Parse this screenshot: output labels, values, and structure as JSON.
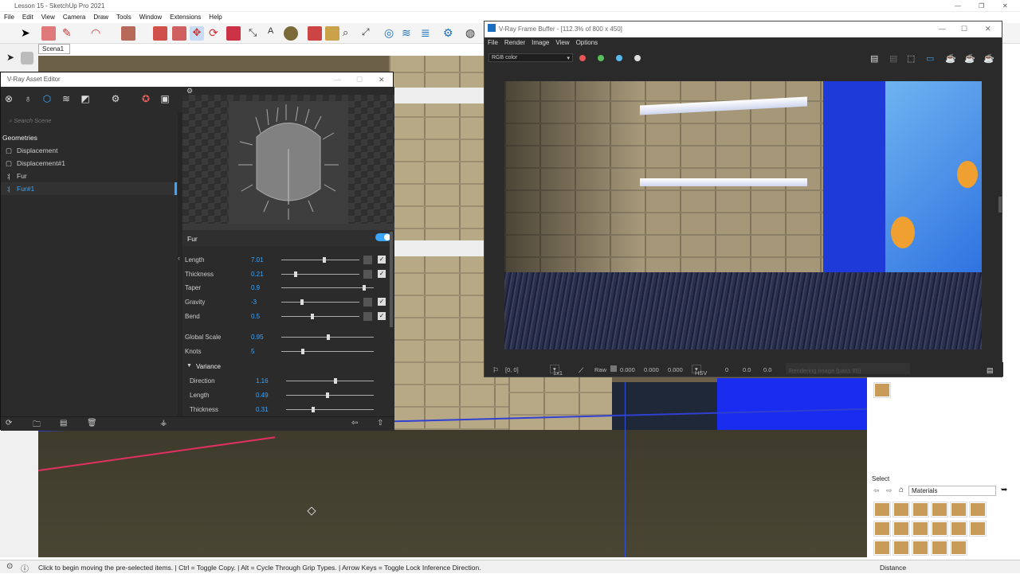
{
  "sketchup": {
    "title": "Lesson 15 - SketchUp Pro 2021",
    "menu": [
      "File",
      "Edit",
      "View",
      "Camera",
      "Draw",
      "Tools",
      "Window",
      "Extensions",
      "Help"
    ],
    "scene_tab": "Scena1",
    "status_message": "Click to begin moving the pre-selected items. | Ctrl = Toggle Copy. | Alt = Cycle Through Grip Types. | Arrow Keys = Toggle Lock Inference Direction.",
    "distance_label": "Distance",
    "materials": {
      "select_label": "Select",
      "dropdown_value": "Materials"
    }
  },
  "asset_editor": {
    "title": "V-Ray Asset Editor",
    "search_placeholder": "Search Scene",
    "category": "Geometries",
    "items": [
      {
        "label": "Displacement",
        "selected": false
      },
      {
        "label": "Displacement#1",
        "selected": false
      },
      {
        "label": "Fur",
        "selected": false
      },
      {
        "label": "Fur#1",
        "selected": true
      }
    ],
    "section_title": "Fur",
    "params": [
      {
        "label": "Length",
        "value": "7.01",
        "slider": 0.55,
        "map": true
      },
      {
        "label": "Thickness",
        "value": "0.21",
        "slider": 0.18,
        "map": true
      },
      {
        "label": "Taper",
        "value": "0.9",
        "slider": 0.9,
        "map": false
      },
      {
        "label": "Gravity",
        "value": "-3",
        "slider": 0.27,
        "map": true
      },
      {
        "label": "Bend",
        "value": "0.5",
        "slider": 0.4,
        "map": true
      },
      {
        "label": "Global Scale",
        "value": "0.95",
        "slider": 0.51,
        "map": false
      },
      {
        "label": "Knots",
        "value": "5",
        "slider": 0.23,
        "map": false
      }
    ],
    "variance_title": "Variance",
    "variance": [
      {
        "label": "Direction",
        "value": "1.16",
        "slider": 0.56
      },
      {
        "label": "Length",
        "value": "0.49",
        "slider": 0.47
      },
      {
        "label": "Thickness",
        "value": "0.31",
        "slider": 0.31
      }
    ]
  },
  "vfb": {
    "title": "V-Ray Frame Buffer - [112.3% of 800 x 450]",
    "menu": [
      "File",
      "Render",
      "Image",
      "View",
      "Options"
    ],
    "channel": "RGB color",
    "status": {
      "coords": "[0, 0]",
      "zoom": "1x1",
      "raw_label": "Raw",
      "r": "0.000",
      "g": "0.000",
      "b": "0.000",
      "mode": "HSV",
      "h": "0",
      "s": "0.0",
      "v": "0.0",
      "progress_text": "Rendering image (pass 85)"
    }
  },
  "colors": {
    "accent_blue": "#3aa6ff",
    "dark_panel": "#2b2b2b",
    "red_dot": "#e45858",
    "green_dot": "#58c058",
    "blue_dot": "#58b8f0"
  }
}
